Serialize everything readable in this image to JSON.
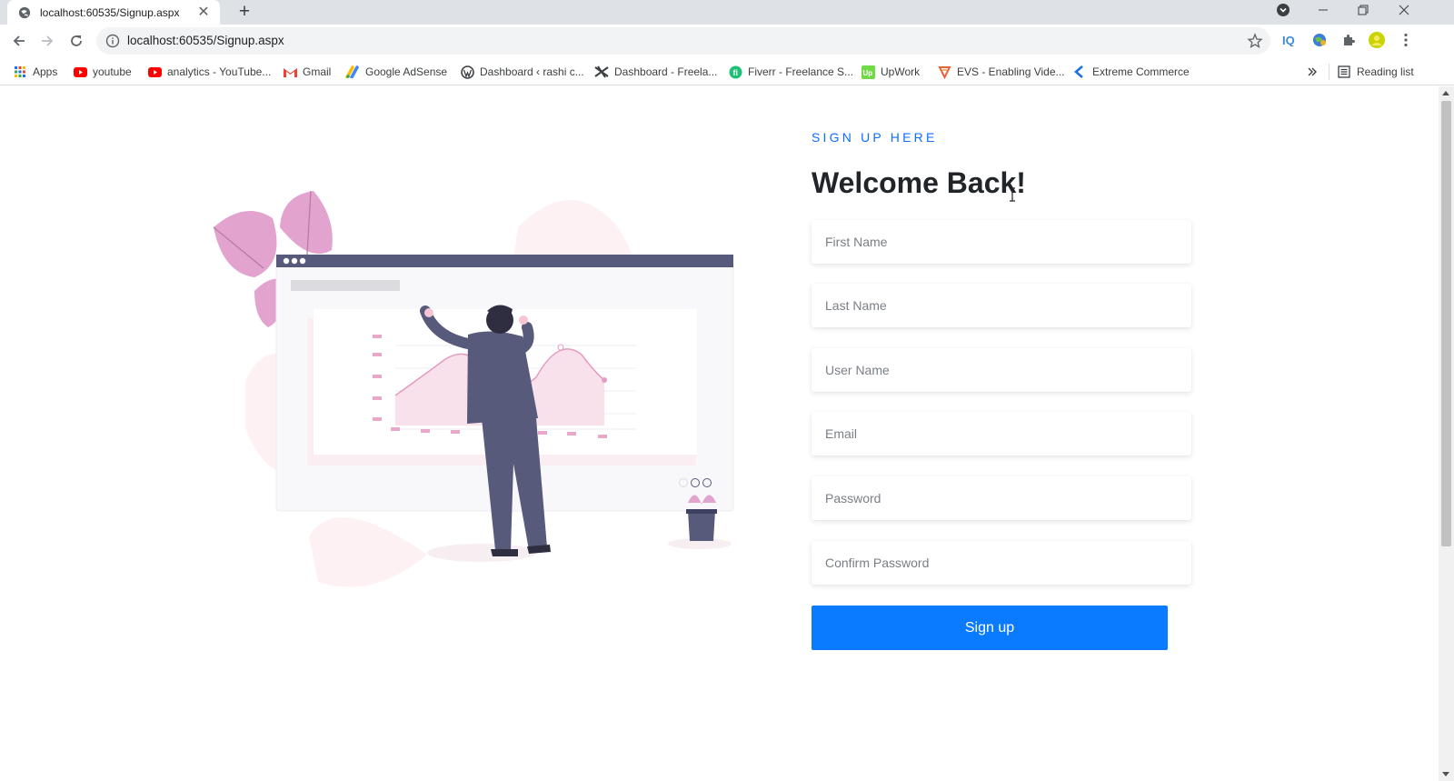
{
  "tab": {
    "title": "localhost:60535/Signup.aspx"
  },
  "omnibox": {
    "url": "localhost:60535/Signup.aspx"
  },
  "bookmarks": [
    {
      "label": "Apps",
      "icon": "apps-grid-icon"
    },
    {
      "label": "youtube",
      "icon": "youtube-icon"
    },
    {
      "label": "analytics - YouTube...",
      "icon": "youtube-icon"
    },
    {
      "label": "Gmail",
      "icon": "gmail-icon"
    },
    {
      "label": "Google AdSense",
      "icon": "adsense-icon"
    },
    {
      "label": "Dashboard ‹ rashi c...",
      "icon": "wordpress-icon"
    },
    {
      "label": "Dashboard - Freela...",
      "icon": "freelancer-icon"
    },
    {
      "label": "Fiverr - Freelance S...",
      "icon": "fiverr-icon"
    },
    {
      "label": "UpWork",
      "icon": "upwork-icon"
    },
    {
      "label": "EVS - Enabling Vide...",
      "icon": "evs-icon"
    },
    {
      "label": "Extreme Commerce",
      "icon": "extreme-commerce-icon"
    }
  ],
  "reading_list": {
    "label": "Reading list"
  },
  "form": {
    "eyebrow": "SIGN UP HERE",
    "heading": "Welcome Back!",
    "first_name_placeholder": "First Name",
    "last_name_placeholder": "Last Name",
    "user_name_placeholder": "User Name",
    "email_placeholder": "Email",
    "password_placeholder": "Password",
    "confirm_password_placeholder": "Confirm Password",
    "submit_label": "Sign up"
  },
  "colors": {
    "accent": "#0a7bff",
    "eyebrow": "#0d6efd",
    "illustration_pink": "#e2a3cf",
    "illustration_navy": "#575a7b"
  }
}
